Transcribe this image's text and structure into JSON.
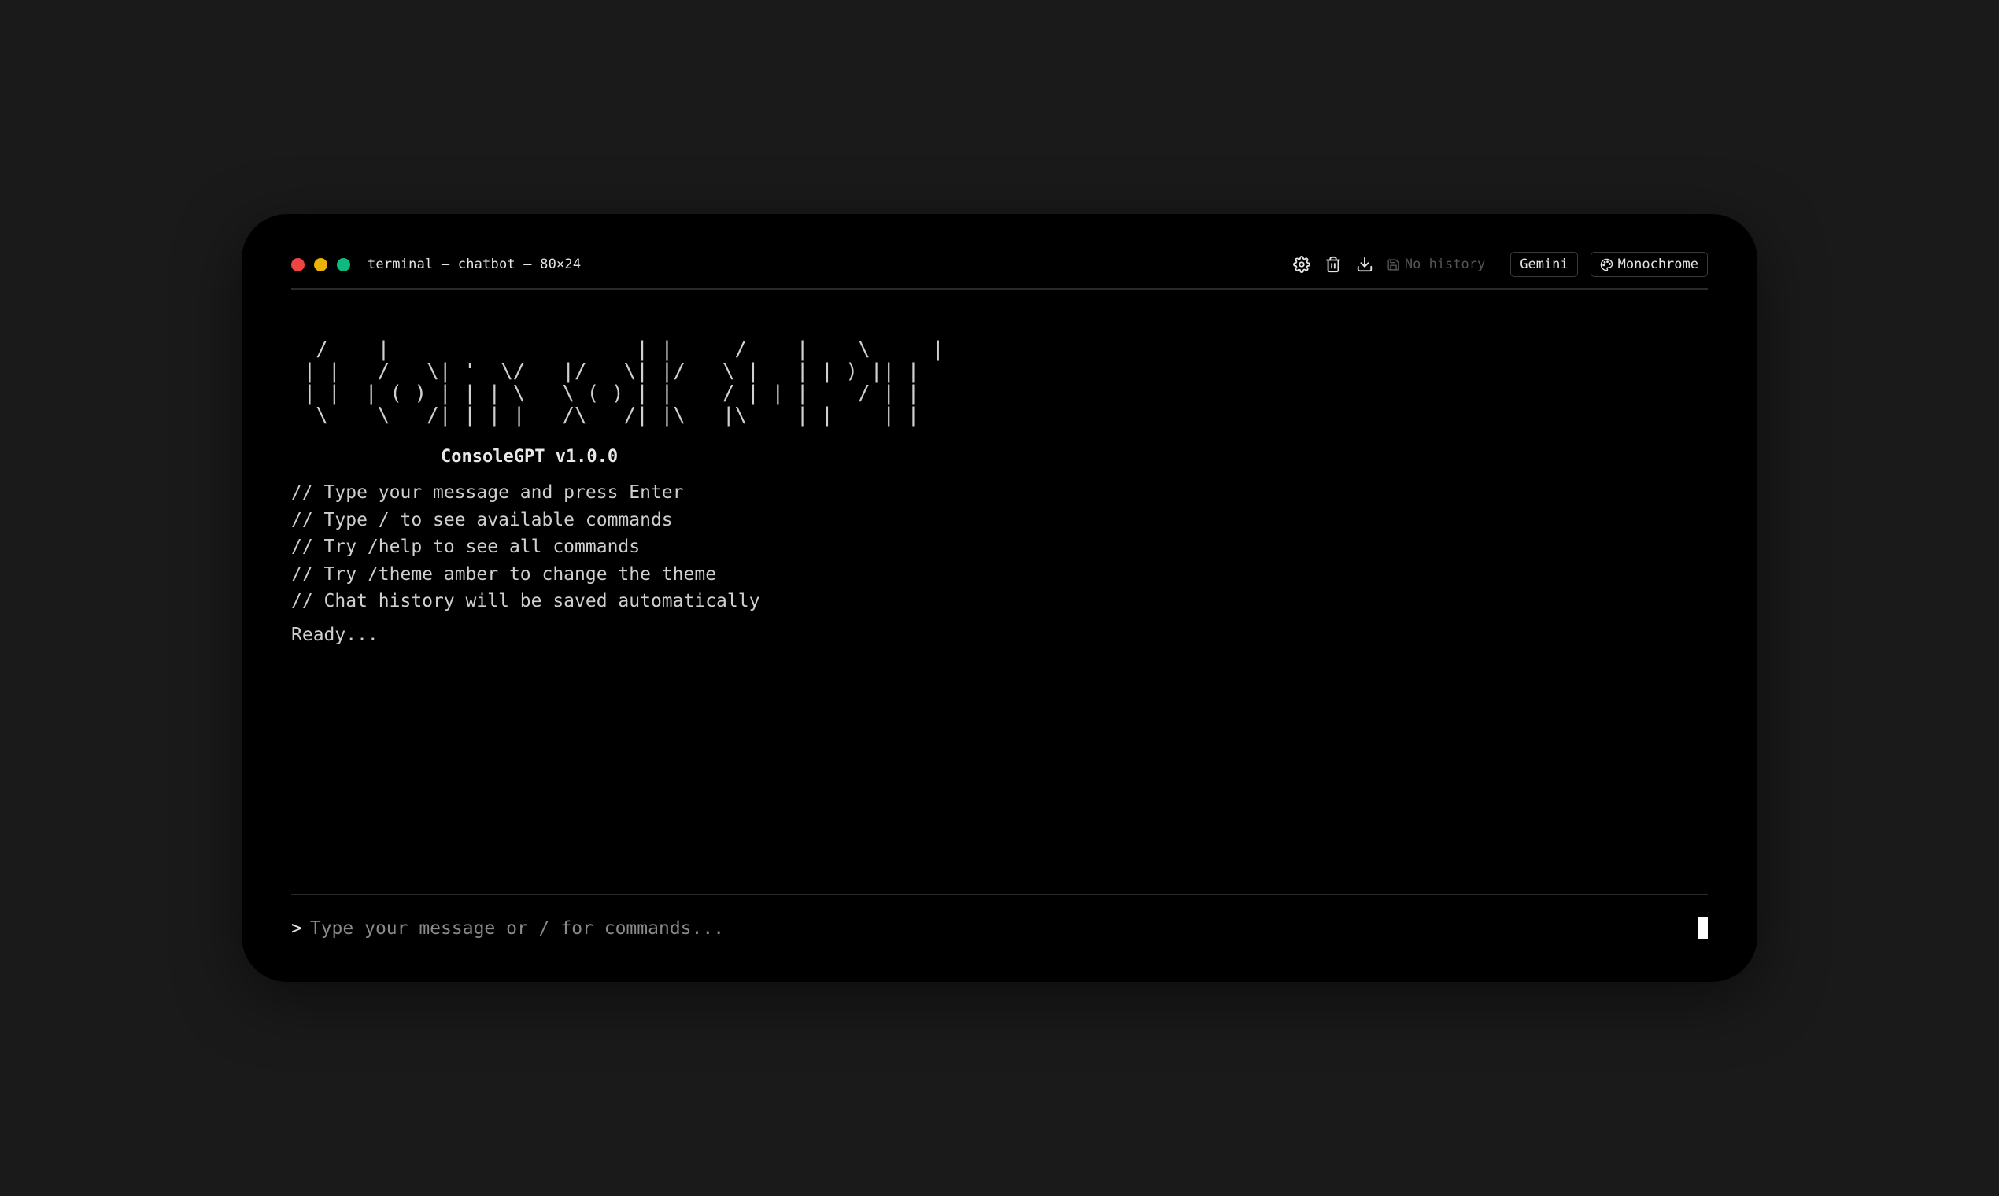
{
  "window": {
    "title": "terminal — chatbot — 80×24",
    "traffic_lights": [
      "#ef4444",
      "#eab308",
      "#10b981"
    ]
  },
  "toolbar": {
    "settings_icon": "gear-icon",
    "clear_icon": "trash-icon",
    "download_icon": "download-icon",
    "history_icon": "save-icon",
    "history_label": "No history",
    "model_label": "Gemini",
    "theme_icon": "palette-icon",
    "theme_label": "Monochrome"
  },
  "banner": {
    "ascii_art": "   ____                      _       ____ ____ _____\n  / ___|___  _ __  ___  ___ | | ___ / ___|  _ \\_   _|\n | |   / _ \\| '_ \\/ __|/ _ \\| |/ _ \\ |  _| |_) || |\n | |__| (_) | | | \\__ \\ (_) | |  __/ |_| |  __/ | |\n  \\____\\___/|_| |_|___/\\___/|_|\\___|\\____|_|    |_|",
    "version": "ConsoleGPT v1.0.0"
  },
  "hints": [
    "// Type your message and press Enter",
    "// Type / to see available commands",
    "// Try /help to see all commands",
    "// Try /theme amber to change the theme",
    "// Chat history will be saved automatically"
  ],
  "status": "Ready...",
  "input": {
    "prompt": ">",
    "placeholder": "Type your message or / for commands...",
    "value": ""
  }
}
